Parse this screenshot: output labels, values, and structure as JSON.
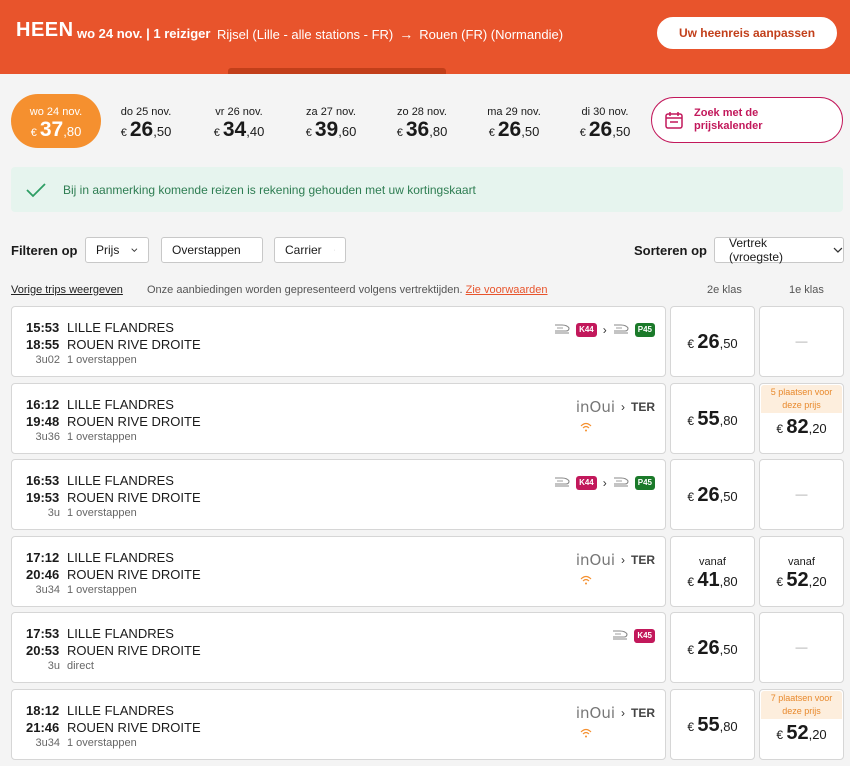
{
  "header": {
    "heen": "HEEN",
    "date_travellers": "wo 24 nov. | 1 reiziger",
    "from": "Rijsel (Lille - alle stations - FR)",
    "arrow": "→",
    "to": "Rouen (FR) (Normandie)",
    "edit_button": "Uw heenreis aanpassen"
  },
  "dates": [
    {
      "label": "wo 24 nov.",
      "currency": "€",
      "euros": "37",
      "cents": ",80",
      "active": true
    },
    {
      "label": "do 25 nov.",
      "currency": "€",
      "euros": "26",
      "cents": ",50"
    },
    {
      "label": "vr 26 nov.",
      "currency": "€",
      "euros": "34",
      "cents": ",40"
    },
    {
      "label": "za 27 nov.",
      "currency": "€",
      "euros": "39",
      "cents": ",60"
    },
    {
      "label": "zo 28 nov.",
      "currency": "€",
      "euros": "36",
      "cents": ",80"
    },
    {
      "label": "ma 29 nov.",
      "currency": "€",
      "euros": "26",
      "cents": ",50"
    },
    {
      "label": "di 30 nov.",
      "currency": "€",
      "euros": "26",
      "cents": ",50"
    }
  ],
  "calendar_button": "Zoek met de prijskalender",
  "banner": "Bij in aanmerking komende reizen is rekening gehouden met uw kortingskaart",
  "filters": {
    "label": "Filteren op",
    "prijs": "Prijs",
    "overstappen": "Overstappen",
    "carrier": "Carrier",
    "sort_label": "Sorteren op",
    "sort_value": "Vertrek (vroegste)"
  },
  "subrow": {
    "prev_trips": "Vorige trips weergeven",
    "offer_note": "Onze aanbiedingen worden gepresenteerd volgens vertrektijden.",
    "conditions_link": "Zie voorwaarden",
    "col_2nd": "2e klas",
    "col_1st": "1e klas"
  },
  "trips": [
    {
      "dep": "15:53",
      "arr": "18:55",
      "from": "LILLE FLANDRES",
      "to": "ROUEN RIVE DROITE",
      "duration": "3u02",
      "changes": "1 overstappen",
      "badges": [
        "K44",
        "P45"
      ],
      "p2": {
        "currency": "€",
        "euros": "26",
        "cents": ",50"
      },
      "p1": {
        "dash": "—"
      }
    },
    {
      "dep": "16:12",
      "arr": "19:48",
      "from": "LILLE FLANDRES",
      "to": "ROUEN RIVE DROITE",
      "duration": "3u36",
      "changes": "1 overstappen",
      "inoui": "inOui",
      "ter": "TER",
      "p2": {
        "currency": "€",
        "euros": "55",
        "cents": ",80"
      },
      "p1": {
        "tag": "5 plaatsen voor deze prijs",
        "currency": "€",
        "euros": "82",
        "cents": ",20"
      }
    },
    {
      "dep": "16:53",
      "arr": "19:53",
      "from": "LILLE FLANDRES",
      "to": "ROUEN RIVE DROITE",
      "duration": "3u",
      "changes": "1 overstappen",
      "badges": [
        "K44",
        "P45"
      ],
      "p2": {
        "currency": "€",
        "euros": "26",
        "cents": ",50"
      },
      "p1": {
        "dash": "—"
      }
    },
    {
      "dep": "17:12",
      "arr": "20:46",
      "from": "LILLE FLANDRES",
      "to": "ROUEN RIVE DROITE",
      "duration": "3u34",
      "changes": "1 overstappen",
      "inoui": "inOui",
      "ter": "TER",
      "p2": {
        "vanaf": "vanaf",
        "currency": "€",
        "euros": "41",
        "cents": ",80"
      },
      "p1": {
        "vanaf": "vanaf",
        "currency": "€",
        "euros": "52",
        "cents": ",20"
      }
    },
    {
      "dep": "17:53",
      "arr": "20:53",
      "from": "LILLE FLANDRES",
      "to": "ROUEN RIVE DROITE",
      "duration": "3u",
      "changes": "direct",
      "badges": [
        "K45"
      ],
      "p2": {
        "currency": "€",
        "euros": "26",
        "cents": ",50"
      },
      "p1": {
        "dash": "—"
      }
    },
    {
      "dep": "18:12",
      "arr": "21:46",
      "from": "LILLE FLANDRES",
      "to": "ROUEN RIVE DROITE",
      "duration": "3u34",
      "changes": "1 overstappen",
      "inoui": "inOui",
      "ter": "TER",
      "p2": {
        "currency": "€",
        "euros": "55",
        "cents": ",80"
      },
      "p1": {
        "tag": "7 plaatsen voor deze prijs",
        "currency": "€",
        "euros": "52",
        "cents": ",20"
      }
    }
  ]
}
